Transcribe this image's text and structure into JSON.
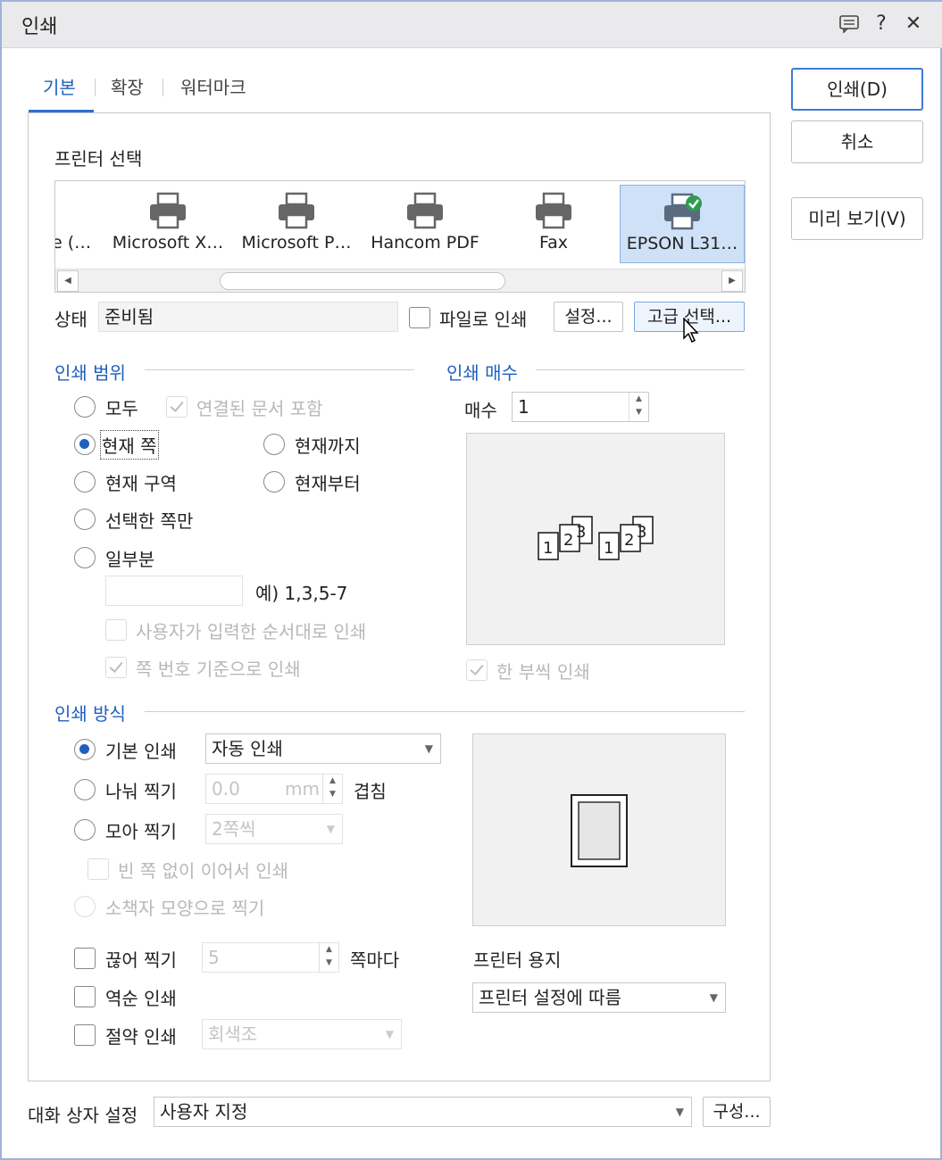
{
  "window": {
    "title": "인쇄",
    "icons": [
      "comment-icon",
      "help-icon",
      "close-icon"
    ],
    "help_glyph": "?",
    "close_glyph": "✕"
  },
  "tabs": [
    {
      "label": "기본",
      "active": true
    },
    {
      "label": "확장",
      "active": false
    },
    {
      "label": "워터마크",
      "active": false
    }
  ],
  "right_buttons": {
    "print": "인쇄(D)",
    "cancel": "취소",
    "preview": "미리 보기(V)"
  },
  "printer_select": {
    "heading": "프린터 선택",
    "printers": [
      {
        "name": "e (…",
        "selected": false
      },
      {
        "name": "Microsoft X…",
        "selected": false
      },
      {
        "name": "Microsoft P…",
        "selected": false
      },
      {
        "name": "Hancom PDF",
        "selected": false
      },
      {
        "name": "Fax",
        "selected": false
      },
      {
        "name": "EPSON L31…",
        "selected": true
      }
    ],
    "status_label": "상태",
    "status_value": "준비됨",
    "print_to_file": "파일로 인쇄",
    "settings_button": "설정...",
    "advanced_button": "고급 선택..."
  },
  "print_range": {
    "heading": "인쇄 범위",
    "all": "모두",
    "include_linked": "연결된 문서 포함",
    "current_page": "현재 쪽",
    "up_to_current": "현재까지",
    "current_section": "현재 구역",
    "from_current": "현재부터",
    "selected_pages": "선택한 쪽만",
    "partial": "일부분",
    "example": "예) 1,3,5-7",
    "user_order": "사용자가 입력한 순서대로 인쇄",
    "by_page_number": "쪽 번호 기준으로 인쇄",
    "selected": "current_page"
  },
  "copies": {
    "heading": "인쇄 매수",
    "label": "매수",
    "value": "1",
    "collate": "한 부씩 인쇄",
    "preview_pages": [
      "1",
      "2",
      "3",
      "1",
      "2",
      "3"
    ]
  },
  "print_method": {
    "heading": "인쇄 방식",
    "basic": "기본 인쇄",
    "basic_option": "자동 인쇄",
    "split": "나눠 찍기",
    "split_value": "0.0",
    "split_unit": "mm",
    "overlap": "겹침",
    "gather": "모아 찍기",
    "gather_option": "2쪽씩",
    "continuous": "빈 쪽 없이 이어서 인쇄",
    "booklet": "소책자 모양으로 찍기",
    "break_print": "끊어 찍기",
    "break_value": "5",
    "per_page": "쪽마다",
    "reverse": "역순 인쇄",
    "saving": "절약 인쇄",
    "saving_option": "회색조",
    "paper_label": "프린터 용지",
    "paper_option": "프린터 설정에 따름",
    "selected": "basic"
  },
  "footer": {
    "dialog_settings_label": "대화 상자 설정",
    "dialog_settings_value": "사용자 지정",
    "configure_button": "구성..."
  },
  "colors": {
    "accent": "#1f5fbf",
    "selection": "#cfe1f7",
    "title_bar": "#eaeaec"
  }
}
